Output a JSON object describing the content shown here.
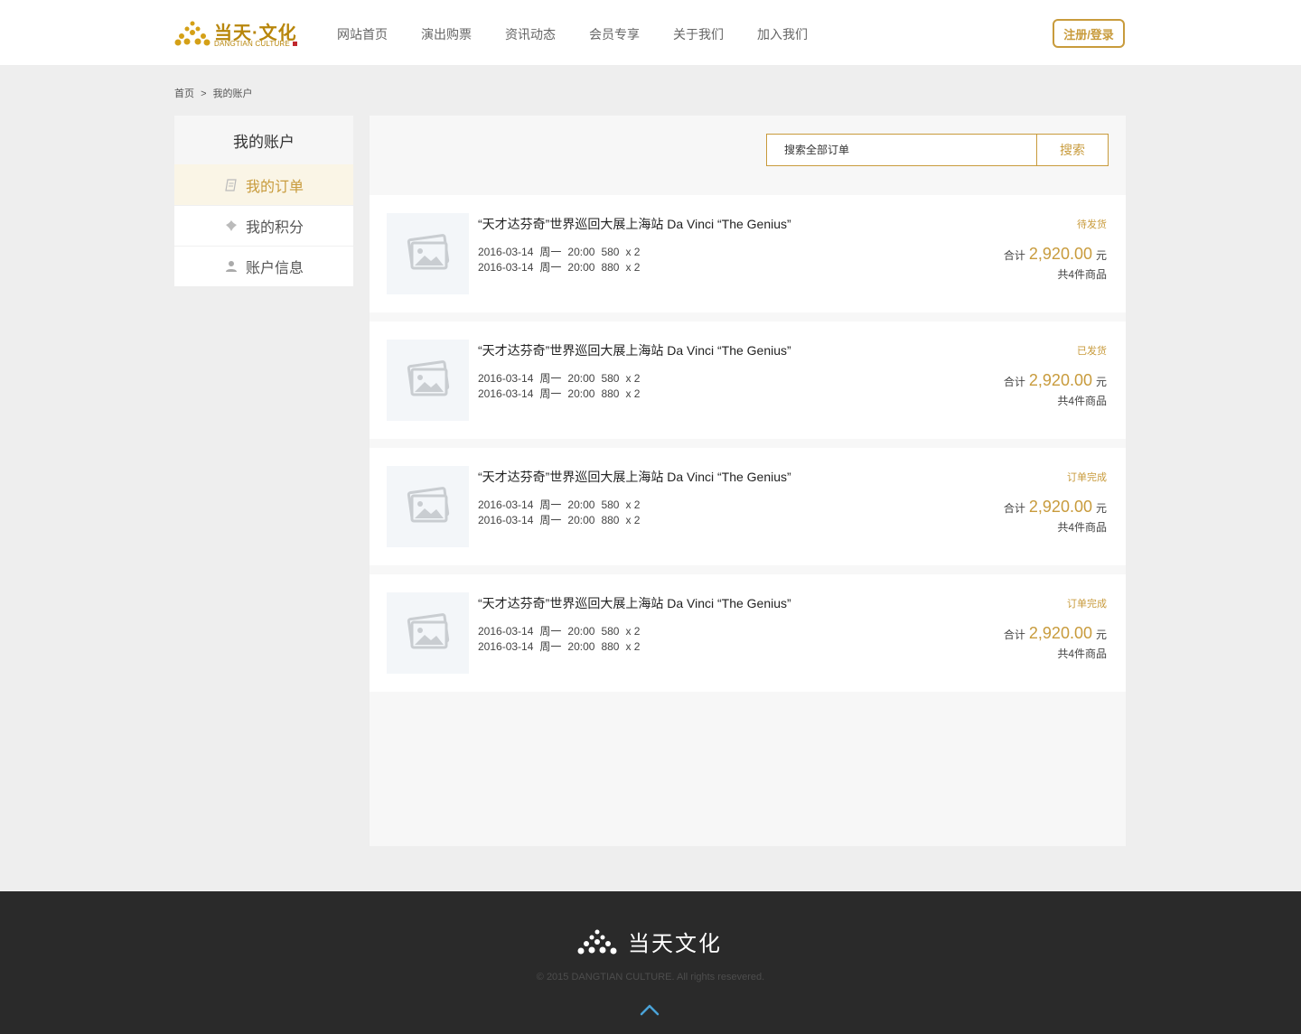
{
  "header": {
    "logo_cn": "当天·文化",
    "logo_en": "DANGTIAN CULTURE",
    "nav": [
      "网站首页",
      "演出购票",
      "资讯动态",
      "会员专享",
      "关于我们",
      "加入我们"
    ],
    "login_label": "注册/登录"
  },
  "breadcrumb": {
    "home": "首页",
    "separator": ">",
    "current": "我的账户"
  },
  "sidebar": {
    "title": "我的账户",
    "items": [
      {
        "label": "我的订单",
        "icon": "order-icon",
        "active": true
      },
      {
        "label": "我的积分",
        "icon": "points-icon",
        "active": false
      },
      {
        "label": "账户信息",
        "icon": "user-icon",
        "active": false
      }
    ]
  },
  "search": {
    "placeholder": "搜索全部订单",
    "button": "搜索"
  },
  "orders": [
    {
      "title": "“天才达芬奇”世界巡回大展上海站 Da Vinci “The Genius”",
      "lines": [
        {
          "date": "2016-03-14",
          "weekday": "周一",
          "time": "20:00",
          "price": "580",
          "qty": "x 2"
        },
        {
          "date": "2016-03-14",
          "weekday": "周一",
          "time": "20:00",
          "price": "880",
          "qty": "x 2"
        }
      ],
      "status": "待发货",
      "total_label": "合计",
      "total": "2,920.00",
      "unit": "元",
      "count": "共4件商品"
    },
    {
      "title": "“天才达芬奇”世界巡回大展上海站 Da Vinci “The Genius”",
      "lines": [
        {
          "date": "2016-03-14",
          "weekday": "周一",
          "time": "20:00",
          "price": "580",
          "qty": "x 2"
        },
        {
          "date": "2016-03-14",
          "weekday": "周一",
          "time": "20:00",
          "price": "880",
          "qty": "x 2"
        }
      ],
      "status": "已发货",
      "total_label": "合计",
      "total": "2,920.00",
      "unit": "元",
      "count": "共4件商品"
    },
    {
      "title": "“天才达芬奇”世界巡回大展上海站 Da Vinci “The Genius”",
      "lines": [
        {
          "date": "2016-03-14",
          "weekday": "周一",
          "time": "20:00",
          "price": "580",
          "qty": "x 2"
        },
        {
          "date": "2016-03-14",
          "weekday": "周一",
          "time": "20:00",
          "price": "880",
          "qty": "x 2"
        }
      ],
      "status": "订单完成",
      "total_label": "合计",
      "total": "2,920.00",
      "unit": "元",
      "count": "共4件商品"
    },
    {
      "title": "“天才达芬奇”世界巡回大展上海站 Da Vinci “The Genius”",
      "lines": [
        {
          "date": "2016-03-14",
          "weekday": "周一",
          "time": "20:00",
          "price": "580",
          "qty": "x 2"
        },
        {
          "date": "2016-03-14",
          "weekday": "周一",
          "time": "20:00",
          "price": "880",
          "qty": "x 2"
        }
      ],
      "status": "订单完成",
      "total_label": "合计",
      "total": "2,920.00",
      "unit": "元",
      "count": "共4件商品"
    }
  ],
  "footer": {
    "logo_text": "当天文化",
    "copyright": "© 2015 DANGTIAN CULTURE. All rights resevered."
  },
  "colors": {
    "accent": "#c89b3c",
    "footer_bg": "#2a2a2a",
    "page_bg": "#eeeeee",
    "back_to_top": "#4aa3d8"
  }
}
